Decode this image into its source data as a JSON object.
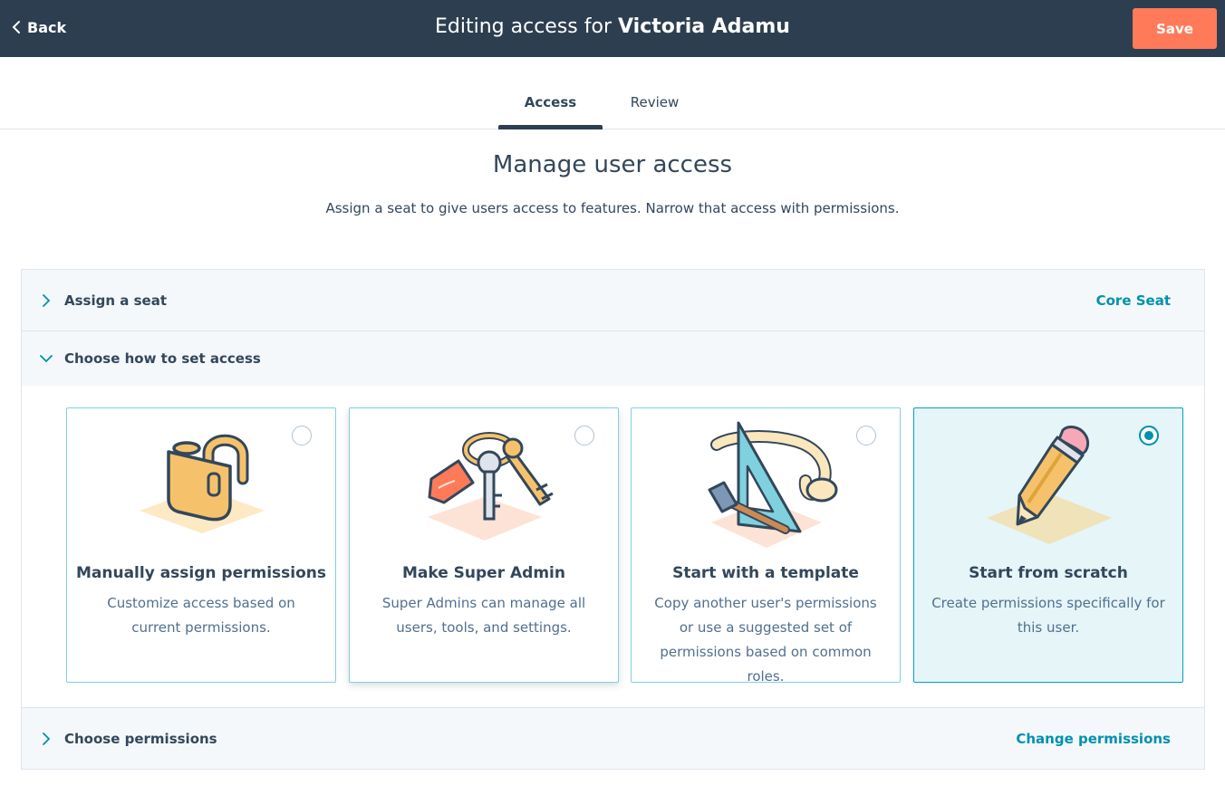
{
  "header": {
    "back_label": "Back",
    "title_prefix": "Editing access for ",
    "title_name": "Victoria Adamu",
    "save_label": "Save"
  },
  "tabs": [
    {
      "label": "Access",
      "active": true
    },
    {
      "label": "Review",
      "active": false
    }
  ],
  "main": {
    "heading": "Manage user access",
    "subheading": "Assign a seat to give users access to features. Narrow that access with permissions."
  },
  "sections": {
    "seat": {
      "label": "Assign a seat",
      "value": "Core Seat",
      "expanded": false
    },
    "how": {
      "label": "Choose how to set access",
      "expanded": true
    },
    "permissions": {
      "label": "Choose permissions",
      "link": "Change permissions",
      "expanded": false
    }
  },
  "options": [
    {
      "title": "Manually assign permissions",
      "desc": "Customize access based on current permissions.",
      "icon": "padlock-icon",
      "selected": false
    },
    {
      "title": "Make Super Admin",
      "desc": "Super Admins can manage all users, tools, and settings.",
      "icon": "keys-icon",
      "selected": false
    },
    {
      "title": "Start with a template",
      "desc": "Copy another user's permissions or use a suggested set of permissions based on common roles.",
      "icon": "tools-icon",
      "selected": false
    },
    {
      "title": "Start from scratch",
      "desc": "Create permissions specifically for this user.",
      "icon": "pencil-icon",
      "selected": true
    }
  ],
  "colors": {
    "header_bg": "#2d3e50",
    "accent": "#ff7a59",
    "link": "#0091ae",
    "selected_bg": "#e5f5f8"
  }
}
